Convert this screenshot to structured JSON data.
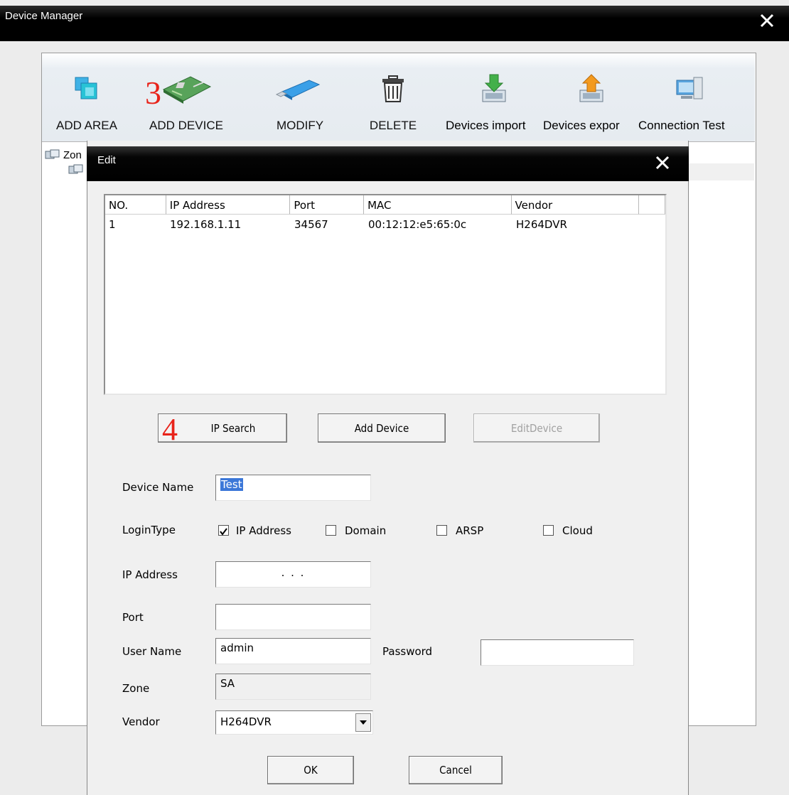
{
  "main_window": {
    "title": "Device Manager",
    "toolbar": [
      {
        "label": "ADD AREA",
        "icon": "add-area-icon"
      },
      {
        "label": "ADD DEVICE",
        "icon": "add-device-card-icon"
      },
      {
        "label": "MODIFY",
        "icon": "modify-usb-icon"
      },
      {
        "label": "DELETE",
        "icon": "trash-icon"
      },
      {
        "label": "Devices import",
        "icon": "import-icon"
      },
      {
        "label": "Devices expor",
        "icon": "export-icon"
      },
      {
        "label": "Connection Test",
        "icon": "connection-test-icon"
      }
    ],
    "tree": {
      "root_label": "Zon"
    }
  },
  "annotations": {
    "step3": "3",
    "step4": "4"
  },
  "edit_dialog": {
    "title": "Edit",
    "table": {
      "columns": [
        "NO.",
        "IP Address",
        "Port",
        "MAC",
        "Vendor",
        ""
      ],
      "rows": [
        [
          "1",
          "192.168.1.11",
          "34567",
          "00:12:12:e5:65:0c",
          "H264DVR"
        ]
      ]
    },
    "buttons": {
      "ip_search": "IP Search",
      "add_device": "Add Device",
      "edit_device": "EditDevice",
      "ok": "OK",
      "cancel": "Cancel"
    },
    "form": {
      "device_name_label": "Device Name",
      "device_name_value": "Test",
      "login_type_label": "LoginType",
      "login_options": [
        {
          "label": "IP Address",
          "checked": true
        },
        {
          "label": "Domain",
          "checked": false
        },
        {
          "label": "ARSP",
          "checked": false
        },
        {
          "label": "Cloud",
          "checked": false
        }
      ],
      "ip_address_label": "IP Address",
      "ip_address_value": ".     .     .",
      "port_label": "Port",
      "port_value": "",
      "user_name_label": "User Name",
      "user_name_value": "admin",
      "password_label": "Password",
      "password_value": "",
      "zone_label": "Zone",
      "zone_value": "SA",
      "vendor_label": "Vendor",
      "vendor_value": "H264DVR"
    }
  },
  "colors": {
    "annotation": "#e8231a",
    "selection": "#3b77d8",
    "titlebar": "#000000"
  }
}
